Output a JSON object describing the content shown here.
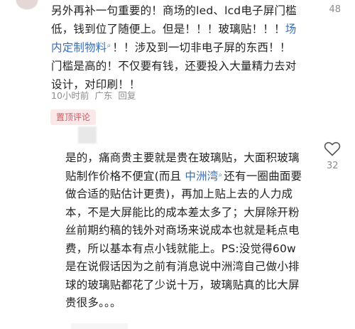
{
  "comment": {
    "text_before_link": "另外再补一句重要的！商场的led、lcd电子屏门槛低，钱到位了随便上。但是！！！玻璃贴！！！",
    "link_text": "场内定制物料",
    "text_after_link": "！！涉及到一切非电子屏的东西！！门槛是高的！不仅要有钱，还要投入大量精力去对设计，对印刷！！",
    "meta_time": "10小时前",
    "meta_location": "广东",
    "meta_reply": "回复",
    "like_count": "48",
    "link_icon": "search-icon"
  },
  "pinned": {
    "label": "置顶评论"
  },
  "reply": {
    "text_before_link": "是的，痛商贵主要就是贵在玻璃贴，大面积玻璃贴制作价格不便宜(而且 ",
    "link_text": "中洲湾",
    "text_after_link": "还有一圈曲面要做合适的贴估计更贵)，再加上贴上去的人力成本，不是大屏能比的成本差太多了；大屏除开粉丝前期约稿的钱外对商场来说成本也就是耗点电费，所以基本有点小钱就能上。PS:没觉得60w是在说假话因为之前有消息说中洲湾自己做小排球的玻璃贴都花了少说十万，玻璃贴真的比大屏贵很多。。。",
    "like_count": "32",
    "like_icon": "heart-outline-icon"
  },
  "colors": {
    "text": "#222222",
    "link": "#3a6fb8",
    "meta": "#8c8c8c",
    "badge_bg": "#fbe9ea",
    "badge_text": "#d2575f"
  }
}
